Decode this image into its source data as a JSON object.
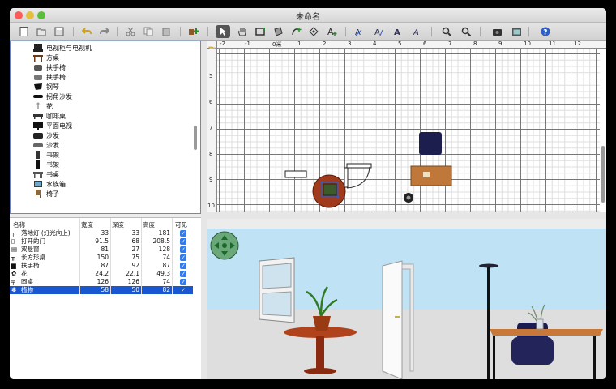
{
  "window": {
    "title": "未命名",
    "traffic_colors": [
      "#fc5b57",
      "#e5bf3c",
      "#57c038"
    ]
  },
  "toolbar": {
    "buttons": [
      "new-file-icon",
      "open-file-icon",
      "save-icon",
      "undo-icon",
      "redo-icon",
      "cut-icon",
      "copy-icon",
      "paste-icon",
      "add-furniture-icon",
      "select-arrow-icon",
      "pan-hand-icon",
      "create-walls-icon",
      "create-rooms-icon",
      "create-polylines-icon",
      "create-dimensions-icon",
      "add-text-icon",
      "text-style-a1-icon",
      "text-style-a2-icon",
      "text-style-a3-icon",
      "text-style-a4-icon",
      "zoom-in-icon",
      "zoom-out-icon",
      "create-photo-icon",
      "create-video-icon",
      "help-icon"
    ]
  },
  "catalog": {
    "items": [
      "电视柜与电视机",
      "方桌",
      "扶手椅",
      "扶手椅",
      "钢琴",
      "拐角沙发",
      "花",
      "咖啡桌",
      "平面电视",
      "沙发",
      "沙发",
      "书架",
      "书架",
      "书桌",
      "水族箱",
      "椅子"
    ]
  },
  "furniture_table": {
    "headers": [
      "名称",
      "宽度",
      "深度",
      "高度",
      "可见"
    ],
    "rows": [
      {
        "name": "落地灯 (灯光向上)",
        "width": "33",
        "depth": "33",
        "height": "181",
        "visible": "✓"
      },
      {
        "name": "打开的门",
        "width": "91.5",
        "depth": "68",
        "height": "208.5",
        "visible": "✓"
      },
      {
        "name": "双悬窗",
        "width": "81",
        "depth": "27",
        "height": "128",
        "visible": "✓"
      },
      {
        "name": "长方形桌",
        "width": "150",
        "depth": "75",
        "height": "74",
        "visible": "✓"
      },
      {
        "name": "扶手椅",
        "width": "87",
        "depth": "92",
        "height": "87",
        "visible": "✓"
      },
      {
        "name": "花",
        "width": "24.2",
        "depth": "22.1",
        "height": "49.3",
        "visible": "✓"
      },
      {
        "name": "圆桌",
        "width": "126",
        "depth": "126",
        "height": "74",
        "visible": "✓"
      },
      {
        "name": "植物",
        "width": "58",
        "depth": "50",
        "height": "82",
        "visible": "✓"
      }
    ],
    "selected_index": 7
  },
  "plan": {
    "ruler_top_labels": [
      "-2",
      "-1",
      "0米",
      "1",
      "2",
      "3",
      "4",
      "5",
      "6",
      "7",
      "8",
      "9",
      "10",
      "11",
      "12"
    ],
    "ruler_left_labels": [
      "5",
      "6",
      "7",
      "8",
      "9",
      "10"
    ]
  },
  "colors": {
    "accent": "#1957d0",
    "selection_border": "#6b86c9",
    "sky": "#bfe3f5",
    "floor": "#dedede"
  }
}
